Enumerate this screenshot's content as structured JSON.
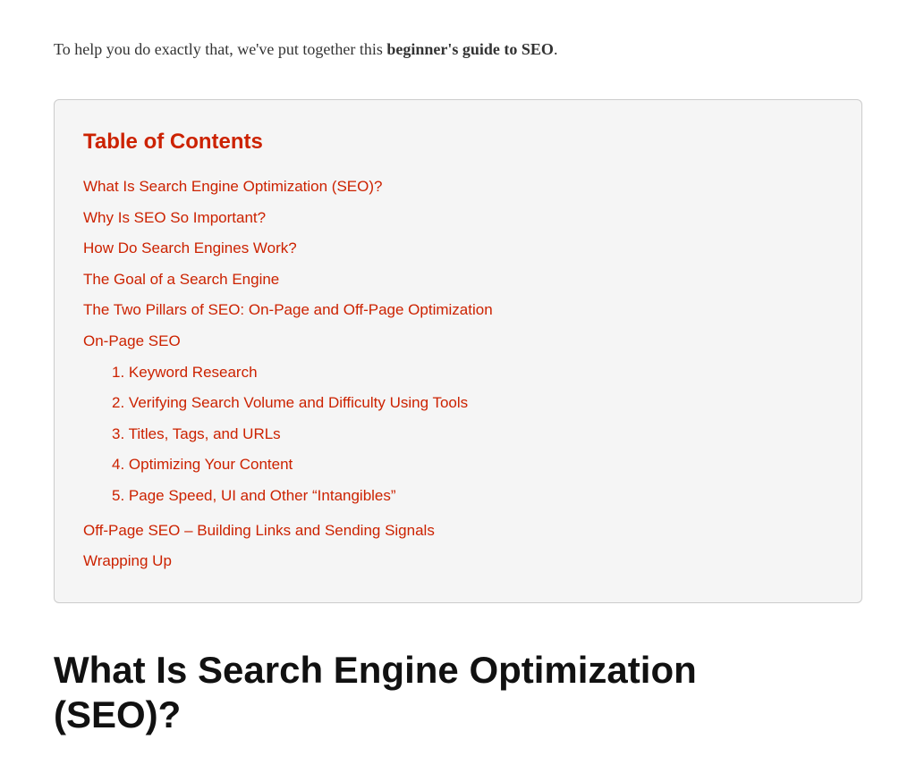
{
  "intro": {
    "text_before_bold": "To help you do exactly that, we've put together this ",
    "bold_text": "beginner's guide to SEO",
    "text_after_bold": "."
  },
  "toc": {
    "title": "Table of Contents",
    "items": [
      {
        "id": "toc-item-1",
        "label": "What Is Search Engine Optimization (SEO)?",
        "href": "#what-is-seo",
        "subitems": []
      },
      {
        "id": "toc-item-2",
        "label": "Why Is SEO So Important?",
        "href": "#why-seo-important",
        "subitems": []
      },
      {
        "id": "toc-item-3",
        "label": "How Do Search Engines Work?",
        "href": "#how-engines-work",
        "subitems": []
      },
      {
        "id": "toc-item-4",
        "label": "The Goal of a Search Engine",
        "href": "#goal-search-engine",
        "subitems": []
      },
      {
        "id": "toc-item-5",
        "label": "The Two Pillars of SEO: On-Page and Off-Page Optimization",
        "href": "#two-pillars",
        "subitems": []
      },
      {
        "id": "toc-item-6",
        "label": "On-Page SEO",
        "href": "#on-page-seo",
        "subitems": [
          {
            "id": "toc-sub-1",
            "number": "1.",
            "label": "Keyword Research",
            "href": "#keyword-research"
          },
          {
            "id": "toc-sub-2",
            "number": "2.",
            "label": "Verifying Search Volume and Difficulty Using Tools",
            "href": "#verifying-search-volume"
          },
          {
            "id": "toc-sub-3",
            "number": "3.",
            "label": "Titles, Tags, and URLs",
            "href": "#titles-tags-urls"
          },
          {
            "id": "toc-sub-4",
            "number": "4.",
            "label": "Optimizing Your Content",
            "href": "#optimizing-content"
          },
          {
            "id": "toc-sub-5",
            "number": "5.",
            "label": "Page Speed, UI and Other “Intangibles”",
            "href": "#page-speed"
          }
        ]
      },
      {
        "id": "toc-item-7",
        "label": "Off-Page SEO – Building Links and Sending Signals",
        "href": "#off-page-seo",
        "subitems": []
      },
      {
        "id": "toc-item-8",
        "label": "Wrapping Up",
        "href": "#wrapping-up",
        "subitems": []
      }
    ]
  },
  "section": {
    "heading_line1": "What Is Search Engine Optimization",
    "heading_line2": "(SEO)?"
  }
}
